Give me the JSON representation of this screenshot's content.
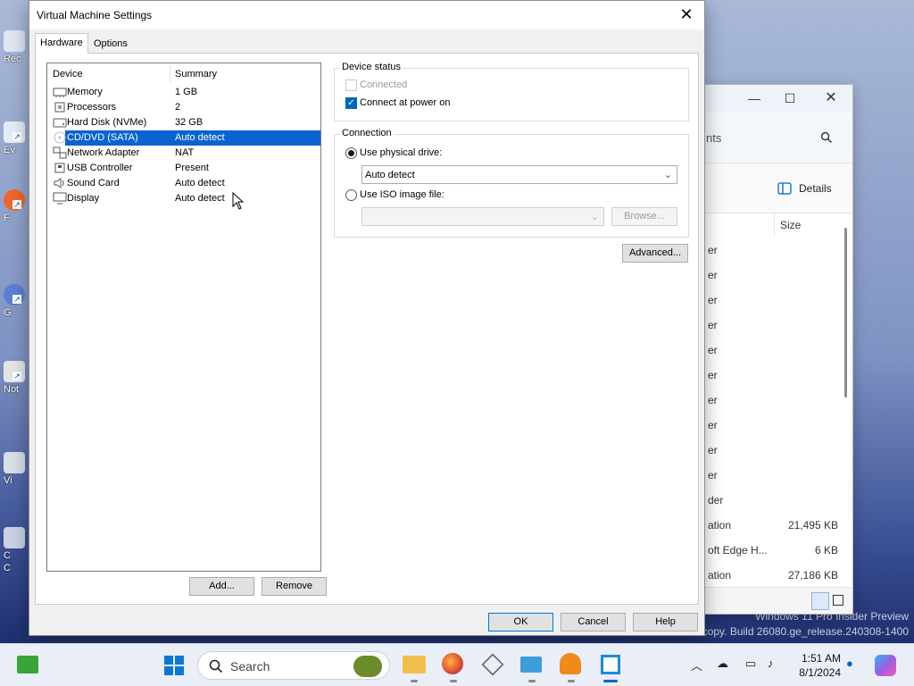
{
  "desktop": {
    "icons": [
      {
        "label": "Rec"
      },
      {
        "label": "Ev"
      },
      {
        "label": "F"
      },
      {
        "label": "G"
      },
      {
        "label": "Not"
      },
      {
        "label": "Vi"
      },
      {
        "label": "C"
      },
      {
        "label": "C"
      }
    ],
    "watermark": {
      "line1": "Windows 11 Pro Insider Preview",
      "line2": "on copy. Build 26080.ge_release.240308-1400"
    }
  },
  "explorer": {
    "address_fragment": "nts",
    "details_label": "Details",
    "size_header": "Size",
    "rows": [
      {
        "name": "er",
        "size": ""
      },
      {
        "name": "er",
        "size": ""
      },
      {
        "name": "er",
        "size": ""
      },
      {
        "name": "er",
        "size": ""
      },
      {
        "name": "er",
        "size": ""
      },
      {
        "name": "er",
        "size": ""
      },
      {
        "name": "er",
        "size": ""
      },
      {
        "name": "er",
        "size": ""
      },
      {
        "name": "er",
        "size": ""
      },
      {
        "name": "er",
        "size": ""
      },
      {
        "name": "der",
        "size": ""
      },
      {
        "name": "ation",
        "size": "21,495 KB"
      },
      {
        "name": "oft Edge H...",
        "size": "6 KB"
      },
      {
        "name": "ation",
        "size": "27,186 KB"
      }
    ]
  },
  "dialog": {
    "title": "Virtual Machine Settings",
    "tabs": [
      "Hardware",
      "Options"
    ],
    "device_header": "Device",
    "summary_header": "Summary",
    "devices": [
      {
        "name": "Memory",
        "summary": "1 GB",
        "icon": "memory-icon"
      },
      {
        "name": "Processors",
        "summary": "2",
        "icon": "processor-icon"
      },
      {
        "name": "Hard Disk (NVMe)",
        "summary": "32 GB",
        "icon": "hard-disk-icon"
      },
      {
        "name": "CD/DVD (SATA)",
        "summary": "Auto detect",
        "icon": "cd-dvd-icon",
        "selected": true
      },
      {
        "name": "Network Adapter",
        "summary": "NAT",
        "icon": "network-icon"
      },
      {
        "name": "USB Controller",
        "summary": "Present",
        "icon": "usb-icon"
      },
      {
        "name": "Sound Card",
        "summary": "Auto detect",
        "icon": "sound-icon"
      },
      {
        "name": "Display",
        "summary": "Auto detect",
        "icon": "display-icon"
      }
    ],
    "add_button": "Add...",
    "remove_button": "Remove",
    "device_status": {
      "legend": "Device status",
      "connected": "Connected",
      "connect_at_power_on": "Connect at power on"
    },
    "connection": {
      "legend": "Connection",
      "use_physical_drive": "Use physical drive:",
      "physical_drive_value": "Auto detect",
      "use_iso_image": "Use ISO image file:",
      "iso_value": "",
      "browse_button": "Browse..."
    },
    "advanced_button": "Advanced...",
    "ok_button": "OK",
    "cancel_button": "Cancel",
    "help_button": "Help"
  },
  "taskbar": {
    "search_placeholder": "Search",
    "time": "1:51 AM",
    "date": "8/1/2024"
  }
}
